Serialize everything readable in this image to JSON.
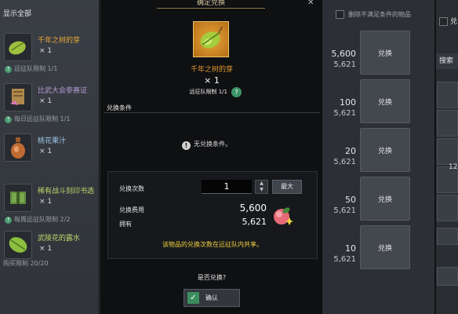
{
  "left_panel": {
    "header": "显示全部",
    "items": [
      {
        "name": "千年之树的芽",
        "qty": "× 1",
        "limit": "远征队限制 1/1",
        "icon": "green-seed-icon"
      },
      {
        "name": "比武大会参赛证",
        "qty": "× 1",
        "limit": "每日远征队限制 1/1",
        "icon": "scroll-ticket-icon"
      },
      {
        "name": "桃花果汁",
        "qty": "× 1",
        "limit": "",
        "icon": "vase-juice-icon"
      },
      {
        "name": "稀有战斗刻印书选",
        "qty": "× 1",
        "limit": "每周远征队限制 2/2",
        "icon": "green-book-icon"
      },
      {
        "name": "武陵花的露水",
        "qty": "× 1",
        "limit": "购买限制 20/20",
        "icon": "green-leaf-icon"
      }
    ]
  },
  "dialog": {
    "title": "确定兑换",
    "item_name": "千年之树的芽",
    "item_qty": "× 1",
    "item_limit": "远征队限制 1/1",
    "conditions_title": "兑换条件",
    "conditions_empty": "无兑换条件。",
    "times_label": "兑换次数",
    "times_value": "1",
    "max_label": "最大",
    "cost_label": "兑换费用",
    "cost_value": "5,600",
    "have_label": "拥有",
    "have_value": "5,621",
    "warning": "该物品的兑换次数在远征队内共享。",
    "confirm_question": "是否兑换?",
    "confirm_label": "确认"
  },
  "right_list": {
    "filter_label": "删除不满足条件的物品",
    "exchange_label": "兑换",
    "rows": [
      {
        "price": "5,600",
        "have": "5,621"
      },
      {
        "price": "100",
        "have": "5,621"
      },
      {
        "price": "20",
        "have": "5,621"
      },
      {
        "price": "50",
        "have": "5,621"
      },
      {
        "price": "10",
        "have": "5,621"
      }
    ]
  },
  "far_right": {
    "top_label": "兑",
    "tab_label": "搜索",
    "nums": [
      "12"
    ]
  },
  "colors": {
    "accent_gold": "#e59a30",
    "warning_yellow": "#f1d33c",
    "confirm_green": "#3a8e5e"
  }
}
